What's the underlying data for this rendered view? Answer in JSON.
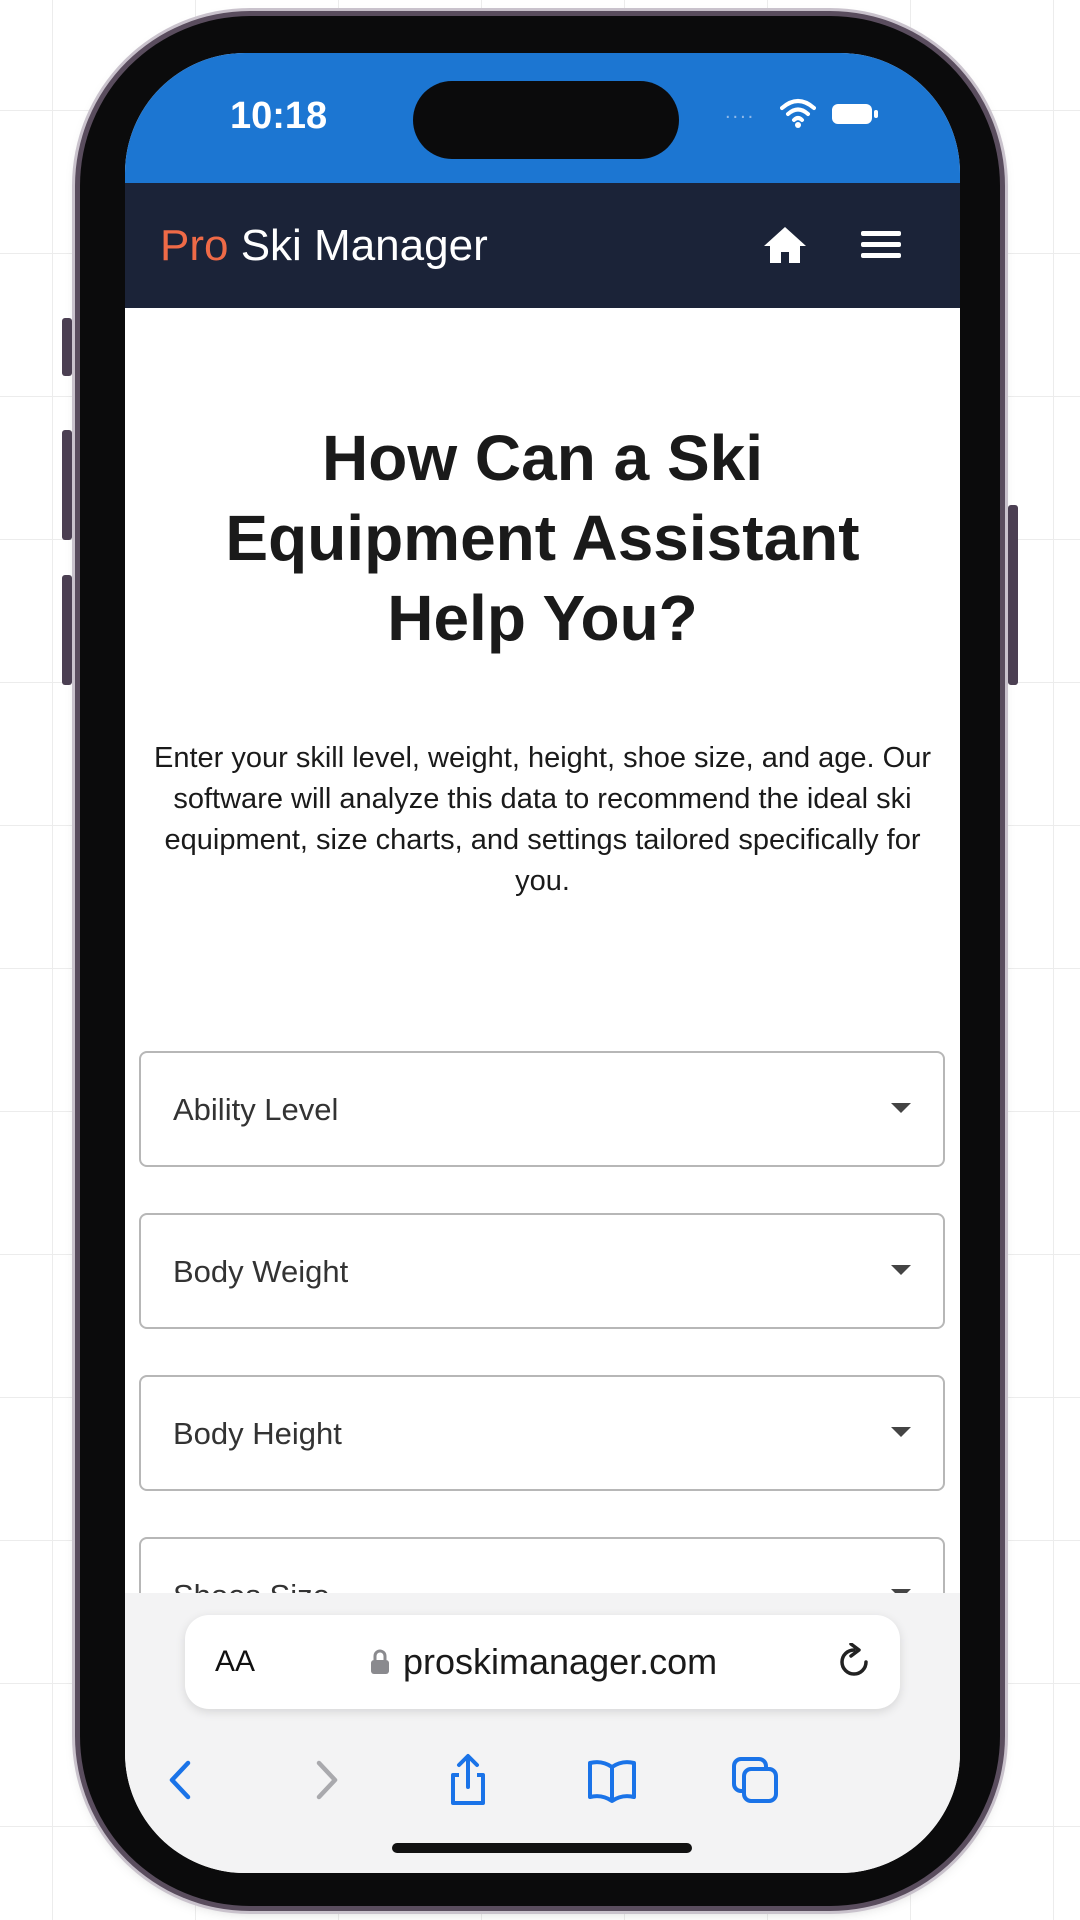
{
  "status_bar": {
    "time": "10:18",
    "signal": "....",
    "icons": [
      "wifi-icon",
      "battery-icon"
    ],
    "color": "#1c76d2"
  },
  "navbar": {
    "brand_accent": "Pro",
    "brand_rest": " Ski Manager",
    "icons": [
      "home-icon",
      "menu-icon"
    ],
    "background": "#1b2338",
    "accent_color": "#ef6a47"
  },
  "main": {
    "title": "How Can a Ski Equipment Assistant Help You?",
    "description": "Enter your skill level, weight, height, shoe size, and age. Our software will analyze this data to recommend the ideal ski equipment, size charts, and settings tailored specifically for you.",
    "fields": [
      {
        "label": "Ability Level"
      },
      {
        "label": "Body Weight"
      },
      {
        "label": "Body Height"
      },
      {
        "label": "Shoes Size"
      }
    ]
  },
  "browser": {
    "text_size_label": "AA",
    "url": "proskimanager.com",
    "toolbar_icons": [
      "back-icon",
      "forward-icon",
      "share-icon",
      "bookmarks-icon",
      "tabs-icon"
    ],
    "accent": "#1a73e8"
  }
}
